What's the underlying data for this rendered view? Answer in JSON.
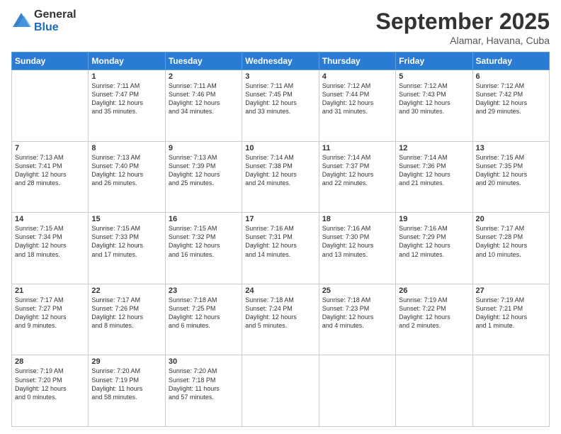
{
  "logo": {
    "general": "General",
    "blue": "Blue"
  },
  "title": "September 2025",
  "subtitle": "Alamar, Havana, Cuba",
  "days_of_week": [
    "Sunday",
    "Monday",
    "Tuesday",
    "Wednesday",
    "Thursday",
    "Friday",
    "Saturday"
  ],
  "weeks": [
    [
      {
        "day": "",
        "info": ""
      },
      {
        "day": "1",
        "info": "Sunrise: 7:11 AM\nSunset: 7:47 PM\nDaylight: 12 hours\nand 35 minutes."
      },
      {
        "day": "2",
        "info": "Sunrise: 7:11 AM\nSunset: 7:46 PM\nDaylight: 12 hours\nand 34 minutes."
      },
      {
        "day": "3",
        "info": "Sunrise: 7:11 AM\nSunset: 7:45 PM\nDaylight: 12 hours\nand 33 minutes."
      },
      {
        "day": "4",
        "info": "Sunrise: 7:12 AM\nSunset: 7:44 PM\nDaylight: 12 hours\nand 31 minutes."
      },
      {
        "day": "5",
        "info": "Sunrise: 7:12 AM\nSunset: 7:43 PM\nDaylight: 12 hours\nand 30 minutes."
      },
      {
        "day": "6",
        "info": "Sunrise: 7:12 AM\nSunset: 7:42 PM\nDaylight: 12 hours\nand 29 minutes."
      }
    ],
    [
      {
        "day": "7",
        "info": "Sunrise: 7:13 AM\nSunset: 7:41 PM\nDaylight: 12 hours\nand 28 minutes."
      },
      {
        "day": "8",
        "info": "Sunrise: 7:13 AM\nSunset: 7:40 PM\nDaylight: 12 hours\nand 26 minutes."
      },
      {
        "day": "9",
        "info": "Sunrise: 7:13 AM\nSunset: 7:39 PM\nDaylight: 12 hours\nand 25 minutes."
      },
      {
        "day": "10",
        "info": "Sunrise: 7:14 AM\nSunset: 7:38 PM\nDaylight: 12 hours\nand 24 minutes."
      },
      {
        "day": "11",
        "info": "Sunrise: 7:14 AM\nSunset: 7:37 PM\nDaylight: 12 hours\nand 22 minutes."
      },
      {
        "day": "12",
        "info": "Sunrise: 7:14 AM\nSunset: 7:36 PM\nDaylight: 12 hours\nand 21 minutes."
      },
      {
        "day": "13",
        "info": "Sunrise: 7:15 AM\nSunset: 7:35 PM\nDaylight: 12 hours\nand 20 minutes."
      }
    ],
    [
      {
        "day": "14",
        "info": "Sunrise: 7:15 AM\nSunset: 7:34 PM\nDaylight: 12 hours\nand 18 minutes."
      },
      {
        "day": "15",
        "info": "Sunrise: 7:15 AM\nSunset: 7:33 PM\nDaylight: 12 hours\nand 17 minutes."
      },
      {
        "day": "16",
        "info": "Sunrise: 7:15 AM\nSunset: 7:32 PM\nDaylight: 12 hours\nand 16 minutes."
      },
      {
        "day": "17",
        "info": "Sunrise: 7:16 AM\nSunset: 7:31 PM\nDaylight: 12 hours\nand 14 minutes."
      },
      {
        "day": "18",
        "info": "Sunrise: 7:16 AM\nSunset: 7:30 PM\nDaylight: 12 hours\nand 13 minutes."
      },
      {
        "day": "19",
        "info": "Sunrise: 7:16 AM\nSunset: 7:29 PM\nDaylight: 12 hours\nand 12 minutes."
      },
      {
        "day": "20",
        "info": "Sunrise: 7:17 AM\nSunset: 7:28 PM\nDaylight: 12 hours\nand 10 minutes."
      }
    ],
    [
      {
        "day": "21",
        "info": "Sunrise: 7:17 AM\nSunset: 7:27 PM\nDaylight: 12 hours\nand 9 minutes."
      },
      {
        "day": "22",
        "info": "Sunrise: 7:17 AM\nSunset: 7:26 PM\nDaylight: 12 hours\nand 8 minutes."
      },
      {
        "day": "23",
        "info": "Sunrise: 7:18 AM\nSunset: 7:25 PM\nDaylight: 12 hours\nand 6 minutes."
      },
      {
        "day": "24",
        "info": "Sunrise: 7:18 AM\nSunset: 7:24 PM\nDaylight: 12 hours\nand 5 minutes."
      },
      {
        "day": "25",
        "info": "Sunrise: 7:18 AM\nSunset: 7:23 PM\nDaylight: 12 hours\nand 4 minutes."
      },
      {
        "day": "26",
        "info": "Sunrise: 7:19 AM\nSunset: 7:22 PM\nDaylight: 12 hours\nand 2 minutes."
      },
      {
        "day": "27",
        "info": "Sunrise: 7:19 AM\nSunset: 7:21 PM\nDaylight: 12 hours\nand 1 minute."
      }
    ],
    [
      {
        "day": "28",
        "info": "Sunrise: 7:19 AM\nSunset: 7:20 PM\nDaylight: 12 hours\nand 0 minutes."
      },
      {
        "day": "29",
        "info": "Sunrise: 7:20 AM\nSunset: 7:19 PM\nDaylight: 11 hours\nand 58 minutes."
      },
      {
        "day": "30",
        "info": "Sunrise: 7:20 AM\nSunset: 7:18 PM\nDaylight: 11 hours\nand 57 minutes."
      },
      {
        "day": "",
        "info": ""
      },
      {
        "day": "",
        "info": ""
      },
      {
        "day": "",
        "info": ""
      },
      {
        "day": "",
        "info": ""
      }
    ]
  ]
}
